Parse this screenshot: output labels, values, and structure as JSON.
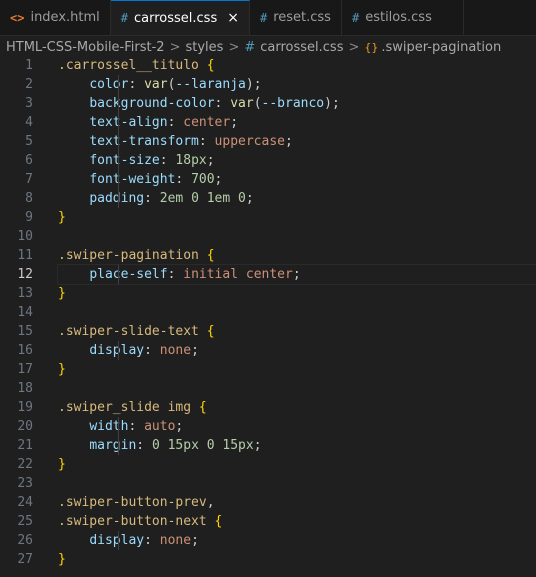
{
  "tabs": [
    {
      "label": "index.html",
      "icon": "html-file-icon",
      "icon_glyph": "<>",
      "active": false
    },
    {
      "label": "carrossel.css",
      "icon": "css-file-icon",
      "icon_glyph": "#",
      "active": true,
      "close": "×"
    },
    {
      "label": "reset.css",
      "icon": "css-file-icon",
      "icon_glyph": "#",
      "active": false
    },
    {
      "label": "estilos.css",
      "icon": "css-file-icon",
      "icon_glyph": "#",
      "active": false
    }
  ],
  "breadcrumb": {
    "project": "HTML-CSS-Mobile-First-2",
    "folder": "styles",
    "file_hash": "#",
    "file": "carrossel.css",
    "symbol_icon": "{}",
    "symbol": ".swiper-pagination",
    "separator": ">"
  },
  "editor": {
    "current_line": 12,
    "lines": [
      {
        "n": "1",
        "guide": false,
        "tokens": [
          [
            "sel",
            ".carrossel__titulo"
          ],
          [
            "punc",
            " "
          ],
          [
            "brace",
            "{"
          ]
        ]
      },
      {
        "n": "2",
        "guide": true,
        "tokens": [
          [
            "punc",
            "    "
          ],
          [
            "prop",
            "color"
          ],
          [
            "punc",
            ": "
          ],
          [
            "fn",
            "var"
          ],
          [
            "punc",
            "("
          ],
          [
            "prop",
            "--laranja"
          ],
          [
            "punc",
            ");"
          ]
        ]
      },
      {
        "n": "3",
        "guide": true,
        "tokens": [
          [
            "punc",
            "    "
          ],
          [
            "prop",
            "background-color"
          ],
          [
            "punc",
            ": "
          ],
          [
            "fn",
            "var"
          ],
          [
            "punc",
            "("
          ],
          [
            "prop",
            "--branco"
          ],
          [
            "punc",
            ");"
          ]
        ]
      },
      {
        "n": "4",
        "guide": true,
        "tokens": [
          [
            "punc",
            "    "
          ],
          [
            "prop",
            "text-align"
          ],
          [
            "punc",
            ": "
          ],
          [
            "val",
            "center"
          ],
          [
            "punc",
            ";"
          ]
        ]
      },
      {
        "n": "5",
        "guide": true,
        "tokens": [
          [
            "punc",
            "    "
          ],
          [
            "prop",
            "text-transform"
          ],
          [
            "punc",
            ": "
          ],
          [
            "val",
            "uppercase"
          ],
          [
            "punc",
            ";"
          ]
        ]
      },
      {
        "n": "6",
        "guide": true,
        "tokens": [
          [
            "punc",
            "    "
          ],
          [
            "prop",
            "font-size"
          ],
          [
            "punc",
            ": "
          ],
          [
            "num",
            "18px"
          ],
          [
            "punc",
            ";"
          ]
        ]
      },
      {
        "n": "7",
        "guide": true,
        "tokens": [
          [
            "punc",
            "    "
          ],
          [
            "prop",
            "font-weight"
          ],
          [
            "punc",
            ": "
          ],
          [
            "num",
            "700"
          ],
          [
            "punc",
            ";"
          ]
        ]
      },
      {
        "n": "8",
        "guide": true,
        "tokens": [
          [
            "punc",
            "    "
          ],
          [
            "prop",
            "padding"
          ],
          [
            "punc",
            ": "
          ],
          [
            "num",
            "2em"
          ],
          [
            "punc",
            " "
          ],
          [
            "num",
            "0"
          ],
          [
            "punc",
            " "
          ],
          [
            "num",
            "1em"
          ],
          [
            "punc",
            " "
          ],
          [
            "num",
            "0"
          ],
          [
            "punc",
            ";"
          ]
        ]
      },
      {
        "n": "9",
        "guide": false,
        "tokens": [
          [
            "brace",
            "}"
          ]
        ]
      },
      {
        "n": "10",
        "guide": false,
        "tokens": []
      },
      {
        "n": "11",
        "guide": false,
        "tokens": [
          [
            "sel",
            ".swiper-pagination"
          ],
          [
            "punc",
            " "
          ],
          [
            "brace",
            "{"
          ]
        ]
      },
      {
        "n": "12",
        "guide": true,
        "tokens": [
          [
            "punc",
            "    "
          ],
          [
            "prop",
            "place-self"
          ],
          [
            "punc",
            ": "
          ],
          [
            "val",
            "initial"
          ],
          [
            "punc",
            " "
          ],
          [
            "val",
            "center"
          ],
          [
            "punc",
            ";"
          ]
        ]
      },
      {
        "n": "13",
        "guide": false,
        "tokens": [
          [
            "brace",
            "}"
          ]
        ]
      },
      {
        "n": "14",
        "guide": false,
        "tokens": []
      },
      {
        "n": "15",
        "guide": false,
        "tokens": [
          [
            "sel",
            ".swiper-slide-text"
          ],
          [
            "punc",
            " "
          ],
          [
            "brace",
            "{"
          ]
        ]
      },
      {
        "n": "16",
        "guide": true,
        "tokens": [
          [
            "punc",
            "    "
          ],
          [
            "prop",
            "display"
          ],
          [
            "punc",
            ": "
          ],
          [
            "val",
            "none"
          ],
          [
            "punc",
            ";"
          ]
        ]
      },
      {
        "n": "17",
        "guide": false,
        "tokens": [
          [
            "brace",
            "}"
          ]
        ]
      },
      {
        "n": "18",
        "guide": false,
        "tokens": []
      },
      {
        "n": "19",
        "guide": false,
        "tokens": [
          [
            "sel",
            ".swiper_slide img"
          ],
          [
            "punc",
            " "
          ],
          [
            "brace",
            "{"
          ]
        ]
      },
      {
        "n": "20",
        "guide": true,
        "tokens": [
          [
            "punc",
            "    "
          ],
          [
            "prop",
            "width"
          ],
          [
            "punc",
            ": "
          ],
          [
            "val",
            "auto"
          ],
          [
            "punc",
            ";"
          ]
        ]
      },
      {
        "n": "21",
        "guide": true,
        "tokens": [
          [
            "punc",
            "    "
          ],
          [
            "prop",
            "margin"
          ],
          [
            "punc",
            ": "
          ],
          [
            "num",
            "0"
          ],
          [
            "punc",
            " "
          ],
          [
            "num",
            "15px"
          ],
          [
            "punc",
            " "
          ],
          [
            "num",
            "0"
          ],
          [
            "punc",
            " "
          ],
          [
            "num",
            "15px"
          ],
          [
            "punc",
            ";"
          ]
        ]
      },
      {
        "n": "22",
        "guide": false,
        "tokens": [
          [
            "brace",
            "}"
          ]
        ]
      },
      {
        "n": "23",
        "guide": false,
        "tokens": []
      },
      {
        "n": "24",
        "guide": false,
        "tokens": [
          [
            "sel",
            ".swiper-button-prev"
          ],
          [
            "punc",
            ","
          ]
        ]
      },
      {
        "n": "25",
        "guide": false,
        "tokens": [
          [
            "sel",
            ".swiper-button-next"
          ],
          [
            "punc",
            " "
          ],
          [
            "brace",
            "{"
          ]
        ]
      },
      {
        "n": "26",
        "guide": true,
        "tokens": [
          [
            "punc",
            "    "
          ],
          [
            "prop",
            "display"
          ],
          [
            "punc",
            ": "
          ],
          [
            "val",
            "none"
          ],
          [
            "punc",
            ";"
          ]
        ]
      },
      {
        "n": "27",
        "guide": false,
        "tokens": [
          [
            "brace",
            "}"
          ]
        ]
      }
    ]
  }
}
